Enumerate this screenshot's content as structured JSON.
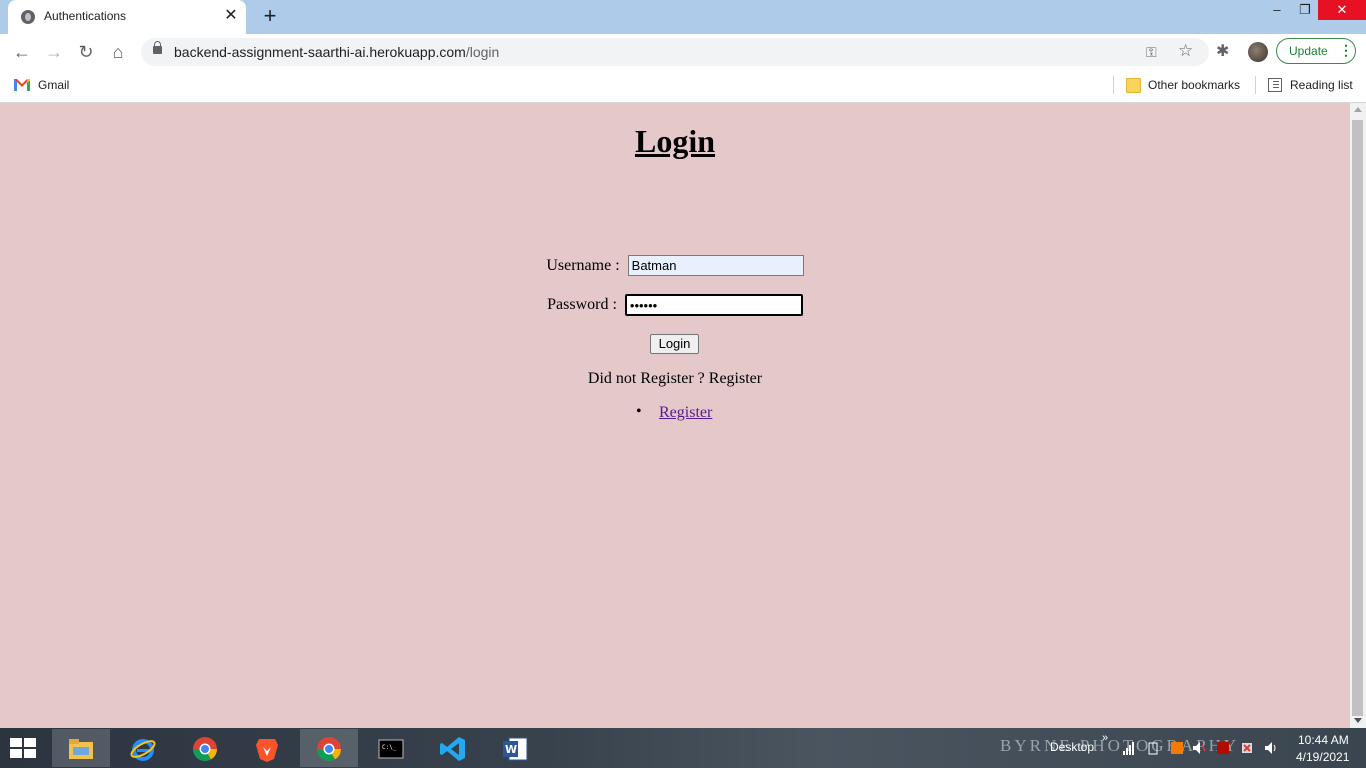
{
  "browser": {
    "tab_title": "Authentications",
    "url_host": "backend-assignment-saarthi-ai.herokuapp.com",
    "url_path": "/login",
    "update_label": "Update",
    "bookmarks": {
      "gmail": "Gmail",
      "other": "Other bookmarks",
      "reading": "Reading list"
    }
  },
  "page": {
    "title": "Login",
    "username_label": "Username :",
    "username_value": "Batman",
    "password_label": "Password :",
    "password_mask": "••••••",
    "login_button": "Login",
    "register_prompt": "Did not Register ? Register",
    "register_link": "Register"
  },
  "taskbar": {
    "apps": [
      "file-explorer",
      "internet-explorer",
      "chrome",
      "brave",
      "chrome-active",
      "command-prompt",
      "vscode",
      "word"
    ],
    "desktop_label": "Desktop",
    "watermark": "BYRNE PHOTOGRAPHY",
    "time": "10:44 AM",
    "date": "4/19/2021"
  },
  "colors": {
    "page_bg": "#e5c8ca",
    "link_visited": "#551a8b",
    "update_green": "#188038"
  }
}
